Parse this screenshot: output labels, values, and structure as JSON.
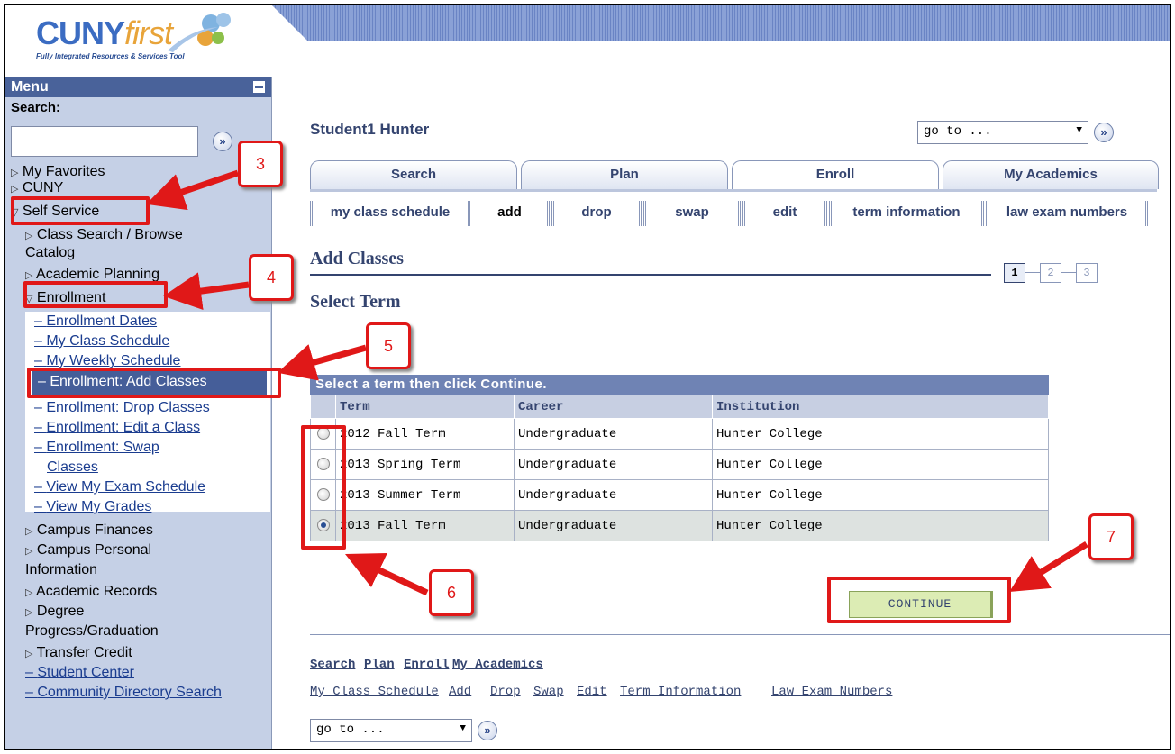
{
  "logo": {
    "main": "CUNY",
    "accent": "first",
    "tagline": "Fully Integrated Resources & Services Tool"
  },
  "sidebar": {
    "menu_title": "Menu",
    "search_label": "Search:",
    "search_go": "»",
    "items": {
      "favorites": "My Favorites",
      "cuny": "CUNY",
      "self_service": "Self Service",
      "class_search_1": "Class Search / Browse",
      "class_search_2": "Catalog",
      "academic_planning": "Academic Planning",
      "enrollment": "Enrollment",
      "campus_finances": "Campus Finances",
      "campus_personal_1": "Campus Personal",
      "campus_personal_2": "Information",
      "academic_records": "Academic Records",
      "degree_1": "Degree",
      "degree_2": "Progress/Graduation",
      "transfer_credit": "Transfer Credit",
      "student_center": "Student Center",
      "community_directory": "Community Directory Search"
    },
    "enrollment_sub": {
      "dates": "Enrollment Dates",
      "class_schedule": "My Class Schedule",
      "weekly_schedule": "My Weekly Schedule",
      "add_classes": "Enrollment: Add Classes",
      "drop_classes": "Enrollment: Drop Classes",
      "edit_class": "Enrollment: Edit a Class",
      "swap_1": "Enrollment: Swap",
      "swap_2": "Classes",
      "exam_schedule": "View My Exam Schedule",
      "grades": "View My Grades"
    }
  },
  "header": {
    "student": "Student1 Hunter",
    "goto": "go to ...",
    "goto_btn": "»"
  },
  "tabs": [
    "Search",
    "Plan",
    "Enroll",
    "My Academics"
  ],
  "subtabs": [
    "my class schedule",
    "add",
    "drop",
    "swap",
    "edit",
    "term information",
    "law exam numbers"
  ],
  "page": {
    "title": "Add Classes",
    "subtitle": "Select Term",
    "steps": [
      "1",
      "2",
      "3"
    ]
  },
  "grid": {
    "caption": "Select a term then click Continue.",
    "columns": [
      "Term",
      "Career",
      "Institution"
    ],
    "rows": [
      {
        "term": "2012 Fall Term",
        "career": "Undergraduate",
        "institution": "Hunter College"
      },
      {
        "term": "2013 Spring Term",
        "career": "Undergraduate",
        "institution": "Hunter College"
      },
      {
        "term": "2013 Summer Term",
        "career": "Undergraduate",
        "institution": "Hunter College"
      },
      {
        "term": "2013 Fall Term",
        "career": "Undergraduate",
        "institution": "Hunter College"
      }
    ]
  },
  "continue_label": "CONTINUE",
  "bottom_links": {
    "primary": [
      "Search",
      "Plan",
      "Enroll",
      "My Academics"
    ],
    "secondary": [
      "My Class Schedule",
      "Add",
      "Drop",
      "Swap",
      "Edit",
      "Term Information",
      "Law Exam Numbers"
    ],
    "goto": "go to ..."
  },
  "callouts": [
    "3",
    "4",
    "5",
    "6",
    "7"
  ],
  "colors": {
    "annotation_red": "#e01818",
    "menu_bg": "#c5d0e6",
    "menu_header": "#49629a",
    "continue_bg": "#dcecb4"
  }
}
